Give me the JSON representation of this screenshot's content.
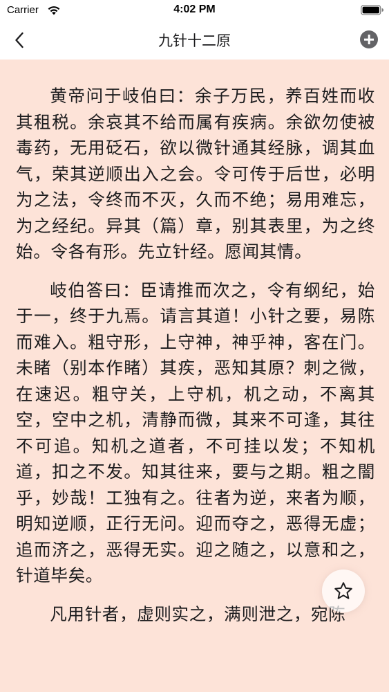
{
  "status_bar": {
    "carrier": "Carrier",
    "time": "4:02 PM"
  },
  "nav": {
    "title": "九针十二原",
    "back_icon": "chevron-left-icon",
    "add_icon": "plus-circle-icon"
  },
  "content": {
    "paragraphs": [
      "黄帝问于岐伯曰：余子万民，养百姓而收其租税。余哀其不给而属有疾病。余欲勿使被毒药，无用砭石，欲以微针通其经脉，调其血气，荣其逆顺出入之会。令可传于后世，必明为之法，令终而不灭，久而不绝；易用难忘，为之经纪。异其（篇）章，别其表里，为之终始。令各有形。先立针经。愿闻其情。",
      "岐伯答曰：臣请推而次之，令有纲纪，始于一，终于九焉。请言其道！小针之要，易陈而难入。粗守形，上守神，神乎神，客在门。未睹（别本作睹）其疾，恶知其原？刺之微，在速迟。粗守关，上守机，机之动，不离其空，空中之机，清静而微，其来不可逢，其往不可追。知机之道者，不可挂以发；不知机道，扣之不发。知其往来，要与之期。粗之闇乎，妙哉！工独有之。往者为逆，来者为顺，明知逆顺，正行无问。迎而夺之，恶得无虚；追而济之，恶得无实。迎之随之，以意和之，针道毕矣。",
      "凡用针者，虚则实之，满则泄之，宛陈"
    ]
  },
  "favorite": {
    "icon": "star-outline-icon"
  },
  "colors": {
    "reading_background": "#fde3d8",
    "bar_background": "#ffffff",
    "text": "#1c1c1e",
    "add_button": "#636366"
  }
}
